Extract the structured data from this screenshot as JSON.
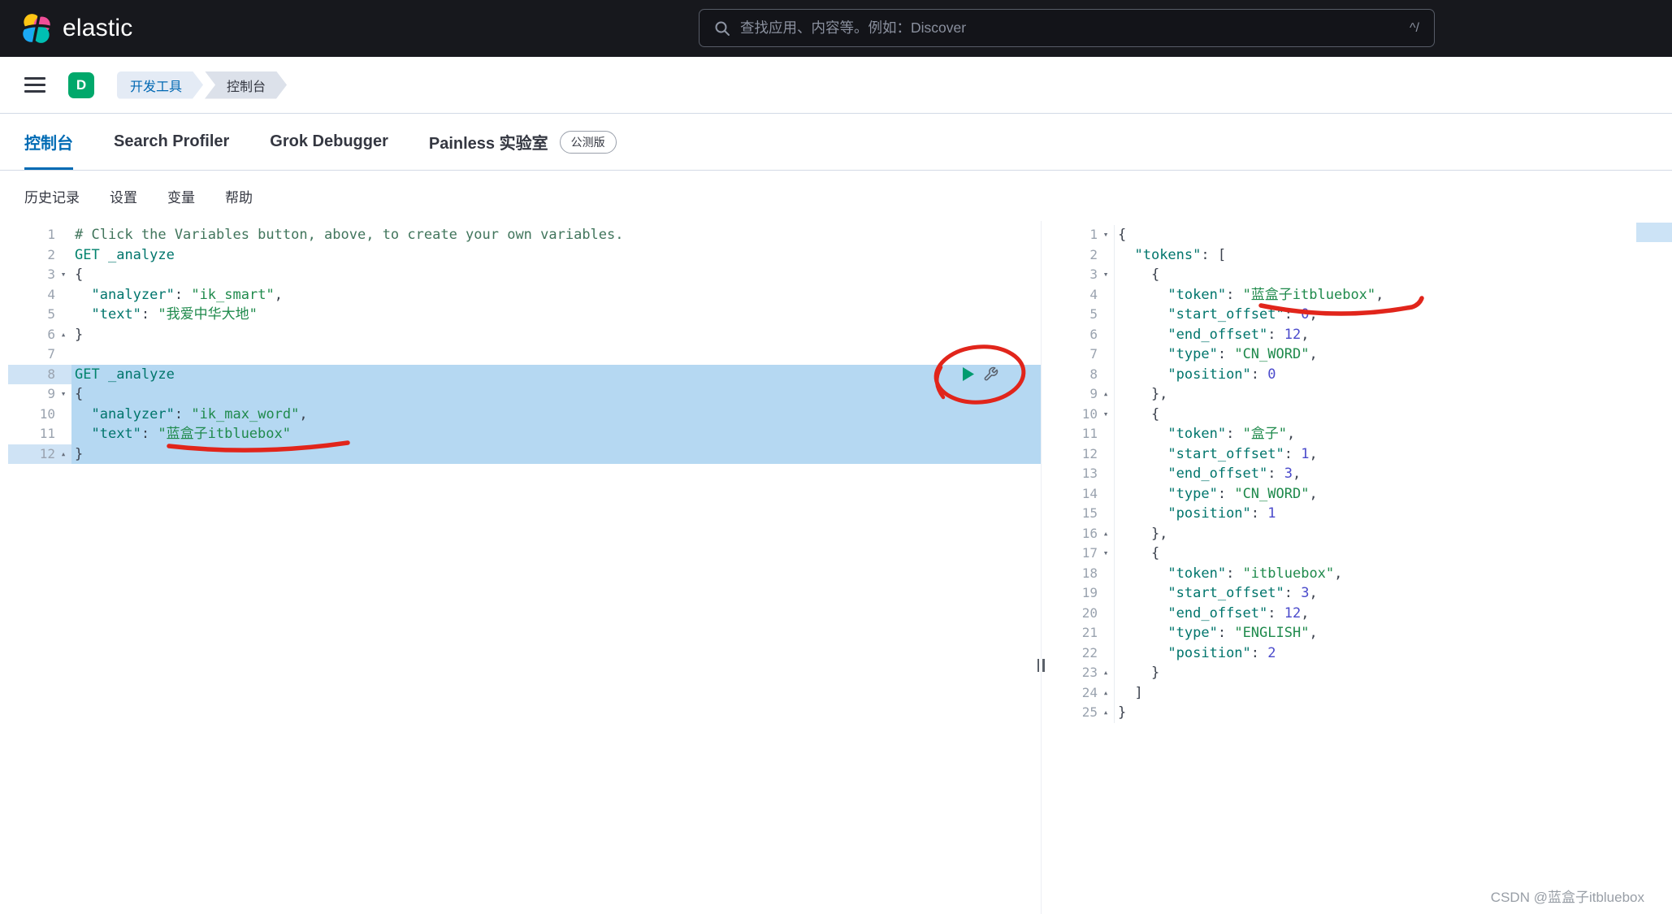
{
  "colors": {
    "accent": "#006BB4",
    "selection": "#B5D8F2",
    "annotation_red": "#E1251B",
    "space_badge": "#00A86B",
    "token_comment": "#41755C",
    "token_method": "#00826C",
    "token_url": "#00756C",
    "token_key": "#00756C",
    "token_string": "#1F8A4C",
    "token_number": "#4A4ACB",
    "token_punct": "#3B414D",
    "play_green": "#019B6F"
  },
  "header": {
    "brand": "elastic",
    "search_placeholder": "查找应用、内容等。例如：Discover",
    "search_shortcut": "^/"
  },
  "nav": {
    "space_initial": "D",
    "breadcrumbs": [
      "开发工具",
      "控制台"
    ]
  },
  "tabs": [
    {
      "label": "控制台",
      "active": true
    },
    {
      "label": "Search Profiler"
    },
    {
      "label": "Grok Debugger"
    },
    {
      "label": "Painless 实验室",
      "badge": "公测版"
    }
  ],
  "console_menu": [
    "历史记录",
    "设置",
    "变量",
    "帮助"
  ],
  "request_editor": {
    "lines": [
      {
        "n": 1,
        "s": [
          [
            "cm",
            "# Click the Variables button, above, to create your own variables."
          ]
        ]
      },
      {
        "n": 2,
        "s": [
          [
            "me",
            "GET"
          ],
          [
            "pu",
            " "
          ],
          [
            "ur",
            "_analyze"
          ]
        ]
      },
      {
        "n": 3,
        "f": "v",
        "s": [
          [
            "pu",
            "{"
          ]
        ]
      },
      {
        "n": 4,
        "s": [
          [
            "pu",
            "  "
          ],
          [
            "ke",
            "\"analyzer\""
          ],
          [
            "pu",
            ": "
          ],
          [
            "st",
            "\"ik_smart\""
          ],
          [
            "pu",
            ","
          ]
        ]
      },
      {
        "n": 5,
        "s": [
          [
            "pu",
            "  "
          ],
          [
            "ke",
            "\"text\""
          ],
          [
            "pu",
            ": "
          ],
          [
            "st",
            "\"我爱中华大地\""
          ]
        ]
      },
      {
        "n": 6,
        "f": "^",
        "s": [
          [
            "pu",
            "}"
          ]
        ]
      },
      {
        "n": 7,
        "s": []
      },
      {
        "n": 8,
        "sel": true,
        "act": true,
        "s": [
          [
            "me",
            "GET"
          ],
          [
            "pu",
            " "
          ],
          [
            "ur",
            "_analyze"
          ]
        ]
      },
      {
        "n": 9,
        "f": "v",
        "sel": true,
        "s": [
          [
            "pu",
            "{"
          ]
        ]
      },
      {
        "n": 10,
        "sel": true,
        "s": [
          [
            "pu",
            "  "
          ],
          [
            "ke",
            "\"analyzer\""
          ],
          [
            "pu",
            ": "
          ],
          [
            "st",
            "\"ik_max_word\""
          ],
          [
            "pu",
            ","
          ]
        ]
      },
      {
        "n": 11,
        "sel": true,
        "s": [
          [
            "pu",
            "  "
          ],
          [
            "ke",
            "\"text\""
          ],
          [
            "pu",
            ": "
          ],
          [
            "st",
            "\"蓝盒子itbluebox\""
          ]
        ]
      },
      {
        "n": 12,
        "f": "^",
        "sel": true,
        "act": true,
        "s": [
          [
            "pu",
            "}"
          ]
        ]
      }
    ]
  },
  "response_editor": {
    "lines": [
      {
        "n": 1,
        "f": "v",
        "s": [
          [
            "pu",
            "{"
          ]
        ]
      },
      {
        "n": 2,
        "s": [
          [
            "pu",
            "  "
          ],
          [
            "ke",
            "\"tokens\""
          ],
          [
            "pu",
            ": ["
          ]
        ]
      },
      {
        "n": 3,
        "f": "v",
        "s": [
          [
            "pu",
            "    {"
          ]
        ]
      },
      {
        "n": 4,
        "s": [
          [
            "pu",
            "      "
          ],
          [
            "ke",
            "\"token\""
          ],
          [
            "pu",
            ": "
          ],
          [
            "st",
            "\"蓝盒子itbluebox\""
          ],
          [
            "pu",
            ","
          ]
        ]
      },
      {
        "n": 5,
        "s": [
          [
            "pu",
            "      "
          ],
          [
            "ke",
            "\"start_offset\""
          ],
          [
            "pu",
            ": "
          ],
          [
            "nu",
            "0"
          ],
          [
            "pu",
            ","
          ]
        ]
      },
      {
        "n": 6,
        "s": [
          [
            "pu",
            "      "
          ],
          [
            "ke",
            "\"end_offset\""
          ],
          [
            "pu",
            ": "
          ],
          [
            "nu",
            "12"
          ],
          [
            "pu",
            ","
          ]
        ]
      },
      {
        "n": 7,
        "s": [
          [
            "pu",
            "      "
          ],
          [
            "ke",
            "\"type\""
          ],
          [
            "pu",
            ": "
          ],
          [
            "st",
            "\"CN_WORD\""
          ],
          [
            "pu",
            ","
          ]
        ]
      },
      {
        "n": 8,
        "s": [
          [
            "pu",
            "      "
          ],
          [
            "ke",
            "\"position\""
          ],
          [
            "pu",
            ": "
          ],
          [
            "nu",
            "0"
          ]
        ]
      },
      {
        "n": 9,
        "f": "^",
        "s": [
          [
            "pu",
            "    },"
          ]
        ]
      },
      {
        "n": 10,
        "f": "v",
        "s": [
          [
            "pu",
            "    {"
          ]
        ]
      },
      {
        "n": 11,
        "s": [
          [
            "pu",
            "      "
          ],
          [
            "ke",
            "\"token\""
          ],
          [
            "pu",
            ": "
          ],
          [
            "st",
            "\"盒子\""
          ],
          [
            "pu",
            ","
          ]
        ]
      },
      {
        "n": 12,
        "s": [
          [
            "pu",
            "      "
          ],
          [
            "ke",
            "\"start_offset\""
          ],
          [
            "pu",
            ": "
          ],
          [
            "nu",
            "1"
          ],
          [
            "pu",
            ","
          ]
        ]
      },
      {
        "n": 13,
        "s": [
          [
            "pu",
            "      "
          ],
          [
            "ke",
            "\"end_offset\""
          ],
          [
            "pu",
            ": "
          ],
          [
            "nu",
            "3"
          ],
          [
            "pu",
            ","
          ]
        ]
      },
      {
        "n": 14,
        "s": [
          [
            "pu",
            "      "
          ],
          [
            "ke",
            "\"type\""
          ],
          [
            "pu",
            ": "
          ],
          [
            "st",
            "\"CN_WORD\""
          ],
          [
            "pu",
            ","
          ]
        ]
      },
      {
        "n": 15,
        "s": [
          [
            "pu",
            "      "
          ],
          [
            "ke",
            "\"position\""
          ],
          [
            "pu",
            ": "
          ],
          [
            "nu",
            "1"
          ]
        ]
      },
      {
        "n": 16,
        "f": "^",
        "s": [
          [
            "pu",
            "    },"
          ]
        ]
      },
      {
        "n": 17,
        "f": "v",
        "s": [
          [
            "pu",
            "    {"
          ]
        ]
      },
      {
        "n": 18,
        "s": [
          [
            "pu",
            "      "
          ],
          [
            "ke",
            "\"token\""
          ],
          [
            "pu",
            ": "
          ],
          [
            "st",
            "\"itbluebox\""
          ],
          [
            "pu",
            ","
          ]
        ]
      },
      {
        "n": 19,
        "s": [
          [
            "pu",
            "      "
          ],
          [
            "ke",
            "\"start_offset\""
          ],
          [
            "pu",
            ": "
          ],
          [
            "nu",
            "3"
          ],
          [
            "pu",
            ","
          ]
        ]
      },
      {
        "n": 20,
        "s": [
          [
            "pu",
            "      "
          ],
          [
            "ke",
            "\"end_offset\""
          ],
          [
            "pu",
            ": "
          ],
          [
            "nu",
            "12"
          ],
          [
            "pu",
            ","
          ]
        ]
      },
      {
        "n": 21,
        "s": [
          [
            "pu",
            "      "
          ],
          [
            "ke",
            "\"type\""
          ],
          [
            "pu",
            ": "
          ],
          [
            "st",
            "\"ENGLISH\""
          ],
          [
            "pu",
            ","
          ]
        ]
      },
      {
        "n": 22,
        "s": [
          [
            "pu",
            "      "
          ],
          [
            "ke",
            "\"position\""
          ],
          [
            "pu",
            ": "
          ],
          [
            "nu",
            "2"
          ]
        ]
      },
      {
        "n": 23,
        "f": "^",
        "s": [
          [
            "pu",
            "    }"
          ]
        ]
      },
      {
        "n": 24,
        "f": "^",
        "s": [
          [
            "pu",
            "  ]"
          ]
        ]
      },
      {
        "n": 25,
        "f": "^",
        "s": [
          [
            "pu",
            "}"
          ]
        ]
      }
    ]
  },
  "watermark": "CSDN @蓝盒子itbluebox"
}
